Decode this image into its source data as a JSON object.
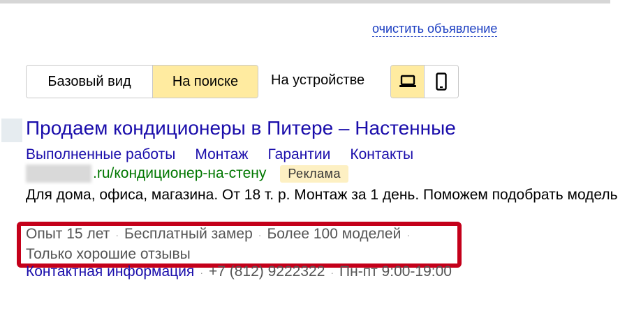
{
  "clear_link": "очистить объявление",
  "view_mode": {
    "options": [
      "Базовый вид",
      "На поиске"
    ],
    "selected": "На поиске"
  },
  "device": {
    "label": "На устройстве",
    "options": [
      "desktop-icon",
      "mobile-icon"
    ],
    "selected": "desktop-icon"
  },
  "ad": {
    "title": "Продаем кондиционеры в Питере – Настенные",
    "sitelinks": [
      "Выполненные работы",
      "Монтаж",
      "Гарантии",
      "Контакты"
    ],
    "url_path": ".ru/кондиционер-на-стену",
    "badge": "Реклама",
    "description": "Для дома, офиса, магазина. От 18 т. р. Монтаж за 1 день. Поможем подобрать модель",
    "callouts": [
      "Опыт 15 лет",
      "Бесплатный замер",
      "Более 100 моделей",
      "Только хорошие отзывы"
    ],
    "separator": "·",
    "contact": {
      "link": "Контактная информация",
      "phone": "+7 (812) 9222322",
      "hours": "Пн-пт 9:00-19:00"
    }
  },
  "colors": {
    "link": "#1a0dab",
    "url": "#007700",
    "selected_segment": "#ffeba0",
    "highlight": "#c4001a"
  }
}
